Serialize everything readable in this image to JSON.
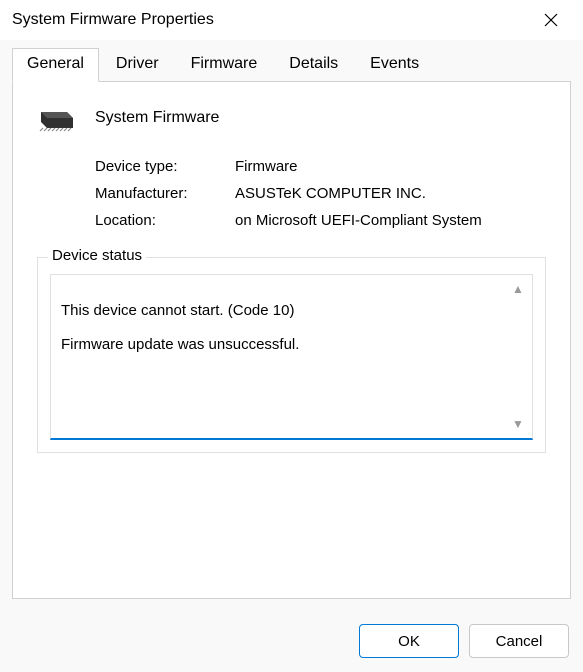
{
  "window": {
    "title": "System Firmware Properties"
  },
  "tabs": {
    "t0": "General",
    "t1": "Driver",
    "t2": "Firmware",
    "t3": "Details",
    "t4": "Events"
  },
  "device": {
    "name": "System Firmware",
    "fields": {
      "type_label": "Device type:",
      "type_value": "Firmware",
      "manufacturer_label": "Manufacturer:",
      "manufacturer_value": "ASUSTeK COMPUTER INC.",
      "location_label": "Location:",
      "location_value": "on Microsoft UEFI-Compliant System"
    }
  },
  "status": {
    "legend": "Device status",
    "text": "This device cannot start. (Code 10)\n\nFirmware update was unsuccessful."
  },
  "buttons": {
    "ok": "OK",
    "cancel": "Cancel"
  }
}
